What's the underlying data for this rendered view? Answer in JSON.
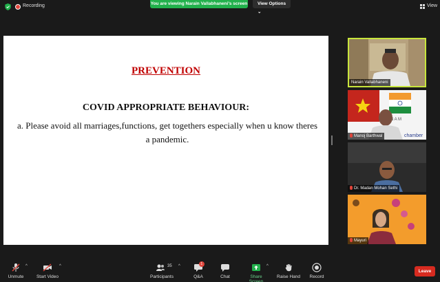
{
  "topbar": {
    "recording_label": "Recording",
    "viewing_banner": "You are viewing Narain Vallabhaneni's screen",
    "view_options_label": "View Options",
    "view_label": "View"
  },
  "slide": {
    "title": "PREVENTION",
    "heading": "COVID APPROPRIATE BEHAVIOUR:",
    "body": "a. Please avoid all marriages,functions, get togethers especially when u know theres a pandemic."
  },
  "participants": [
    {
      "name": "Narain Vallabhaneni",
      "muted": false,
      "active": true
    },
    {
      "name": "Manoj Barthwal",
      "muted": true,
      "active": false,
      "background_text": "chamber"
    },
    {
      "name": "Dr. Madan Mohan Sethi",
      "muted": true,
      "active": false
    },
    {
      "name": "Mayuri",
      "muted": true,
      "active": false
    }
  ],
  "toolbar": {
    "unmute_label": "Unmute",
    "start_video_label": "Start Video",
    "participants_label": "Participants",
    "participants_count": "35",
    "qa_label": "Q&A",
    "qa_badge": "1",
    "chat_label": "Chat",
    "share_screen_label": "Share Screen",
    "raise_hand_label": "Raise Hand",
    "record_label": "Record",
    "leave_label": "Leave"
  },
  "colors": {
    "banner_green": "#22b14c",
    "share_green": "#22b14c",
    "leave_red": "#d72b20",
    "slide_title_red": "#c00000",
    "active_speaker_border": "#c8e63c"
  }
}
